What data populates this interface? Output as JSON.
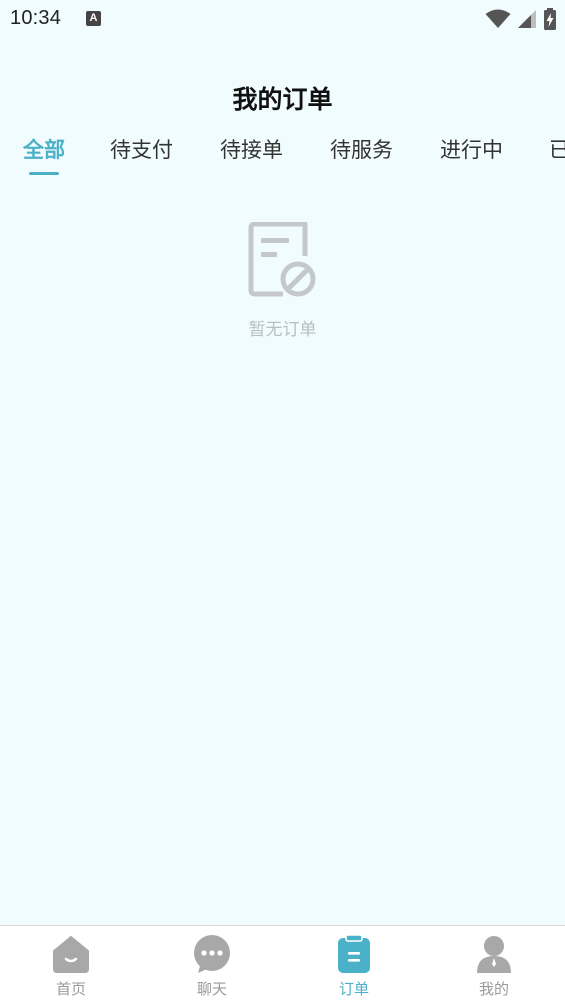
{
  "status_bar": {
    "time": "10:34",
    "notification_badge": "A"
  },
  "header": {
    "title": "我的订单"
  },
  "tabs": [
    {
      "label": "全部",
      "active": true
    },
    {
      "label": "待支付",
      "active": false
    },
    {
      "label": "待接单",
      "active": false
    },
    {
      "label": "待服务",
      "active": false
    },
    {
      "label": "进行中",
      "active": false
    },
    {
      "label": "已",
      "active": false
    }
  ],
  "empty_state": {
    "icon": "no-order-icon",
    "text": "暂无订单"
  },
  "bottom_nav": {
    "items": [
      {
        "label": "首页",
        "icon": "home-icon",
        "active": false
      },
      {
        "label": "聊天",
        "icon": "chat-icon",
        "active": false
      },
      {
        "label": "订单",
        "icon": "order-icon",
        "active": true
      },
      {
        "label": "我的",
        "icon": "profile-icon",
        "active": false
      }
    ]
  },
  "colors": {
    "accent": "#4bb1c9",
    "background": "#f1fcfe",
    "inactive_gray": "#9a9a9a"
  }
}
